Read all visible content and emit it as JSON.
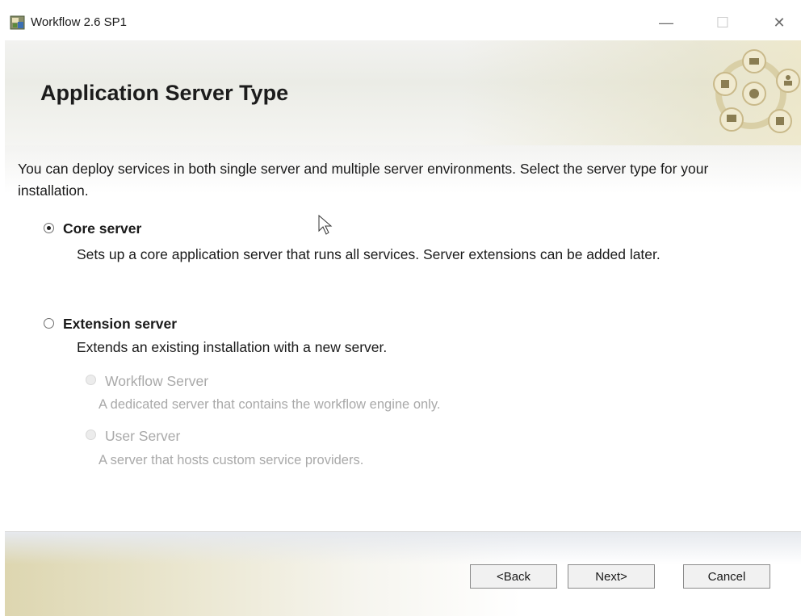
{
  "window": {
    "title": "Workflow 2.6 SP1",
    "controls": {
      "minimize": "—",
      "maximize": "☐",
      "close": "✕"
    }
  },
  "header": {
    "title": "Application Server Type"
  },
  "content": {
    "intro": "You can deploy services in both single server and multiple server environments. Select the server type for your installation.",
    "options": [
      {
        "label": "Core server",
        "description": "Sets up a core application server that runs all services. Server extensions can be added later.",
        "selected": true,
        "enabled": true
      },
      {
        "label": "Extension server",
        "description": "Extends an existing installation with a new server.",
        "selected": false,
        "enabled": true,
        "sub_options": [
          {
            "label": "Workflow Server",
            "description": "A dedicated server that contains the workflow engine only.",
            "enabled": false
          },
          {
            "label": "User Server",
            "description": "A server that hosts custom service providers.",
            "enabled": false
          }
        ]
      }
    ]
  },
  "footer": {
    "back_label": "<Back",
    "next_label": "Next>",
    "cancel_label": "Cancel"
  },
  "colors": {
    "header_band": "#ebece6",
    "header_accent": "#e2dcb8",
    "icon_ring": "#c9b98a",
    "disabled_text": "#a9a9a9"
  }
}
